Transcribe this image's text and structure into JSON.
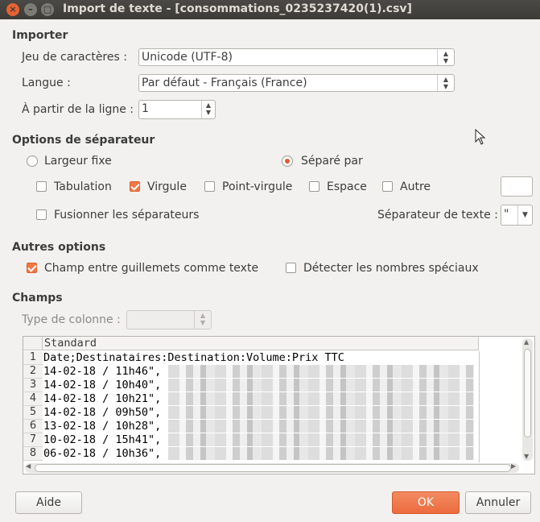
{
  "window": {
    "title": "Import de texte - [consommations_0235237420(1).csv]"
  },
  "importer": {
    "section": "Importer",
    "charset_label": "Jeu de caractères :",
    "charset_value": "Unicode (UTF-8)",
    "language_label": "Langue :",
    "language_value": "Par défaut - Français (France)",
    "from_line_label": "À partir de la ligne :",
    "from_line_value": "1"
  },
  "separator": {
    "section": "Options de séparateur",
    "fixed_width": "Largeur fixe",
    "separated_by": "Séparé par",
    "tab": "Tabulation",
    "comma": "Virgule",
    "semicolon": "Point-virgule",
    "space": "Espace",
    "other": "Autre",
    "other_value": "",
    "merge": "Fusionner les séparateurs",
    "text_delimiter_label": "Séparateur de texte :",
    "text_delimiter_value": "\"",
    "state": {
      "fixed_width": false,
      "separated_by": true,
      "tab": false,
      "comma": true,
      "semicolon": false,
      "space": false,
      "other": false,
      "merge": false
    }
  },
  "other_options": {
    "section": "Autres options",
    "quoted_as_text": "Champ entre guillemets comme texte",
    "detect_special_numbers": "Détecter les nombres spéciaux",
    "state": {
      "quoted_as_text": true,
      "detect_special_numbers": false
    }
  },
  "fields": {
    "section": "Champs",
    "column_type_label": "Type de colonne :",
    "column_type_value": "",
    "column_header": "Standard",
    "rows": [
      {
        "n": "1",
        "text": "Date;Destinataires:Destination:Volume:Prix TTC"
      },
      {
        "n": "2",
        "text": "14-02-18 / 11h46\","
      },
      {
        "n": "3",
        "text": "14-02-18 / 10h40\","
      },
      {
        "n": "4",
        "text": "14-02-18 / 10h21\","
      },
      {
        "n": "5",
        "text": "14-02-18 / 09h50\","
      },
      {
        "n": "6",
        "text": "13-02-18 / 10h28\","
      },
      {
        "n": "7",
        "text": "10-02-18 / 15h41\","
      },
      {
        "n": "8",
        "text": "06-02-18 / 10h36\","
      }
    ]
  },
  "buttons": {
    "help": "Aide",
    "ok": "OK",
    "cancel": "Annuler"
  },
  "colors": {
    "accent": "#f07746",
    "titlebar": "#3c3b37",
    "background": "#f2f1f0"
  }
}
